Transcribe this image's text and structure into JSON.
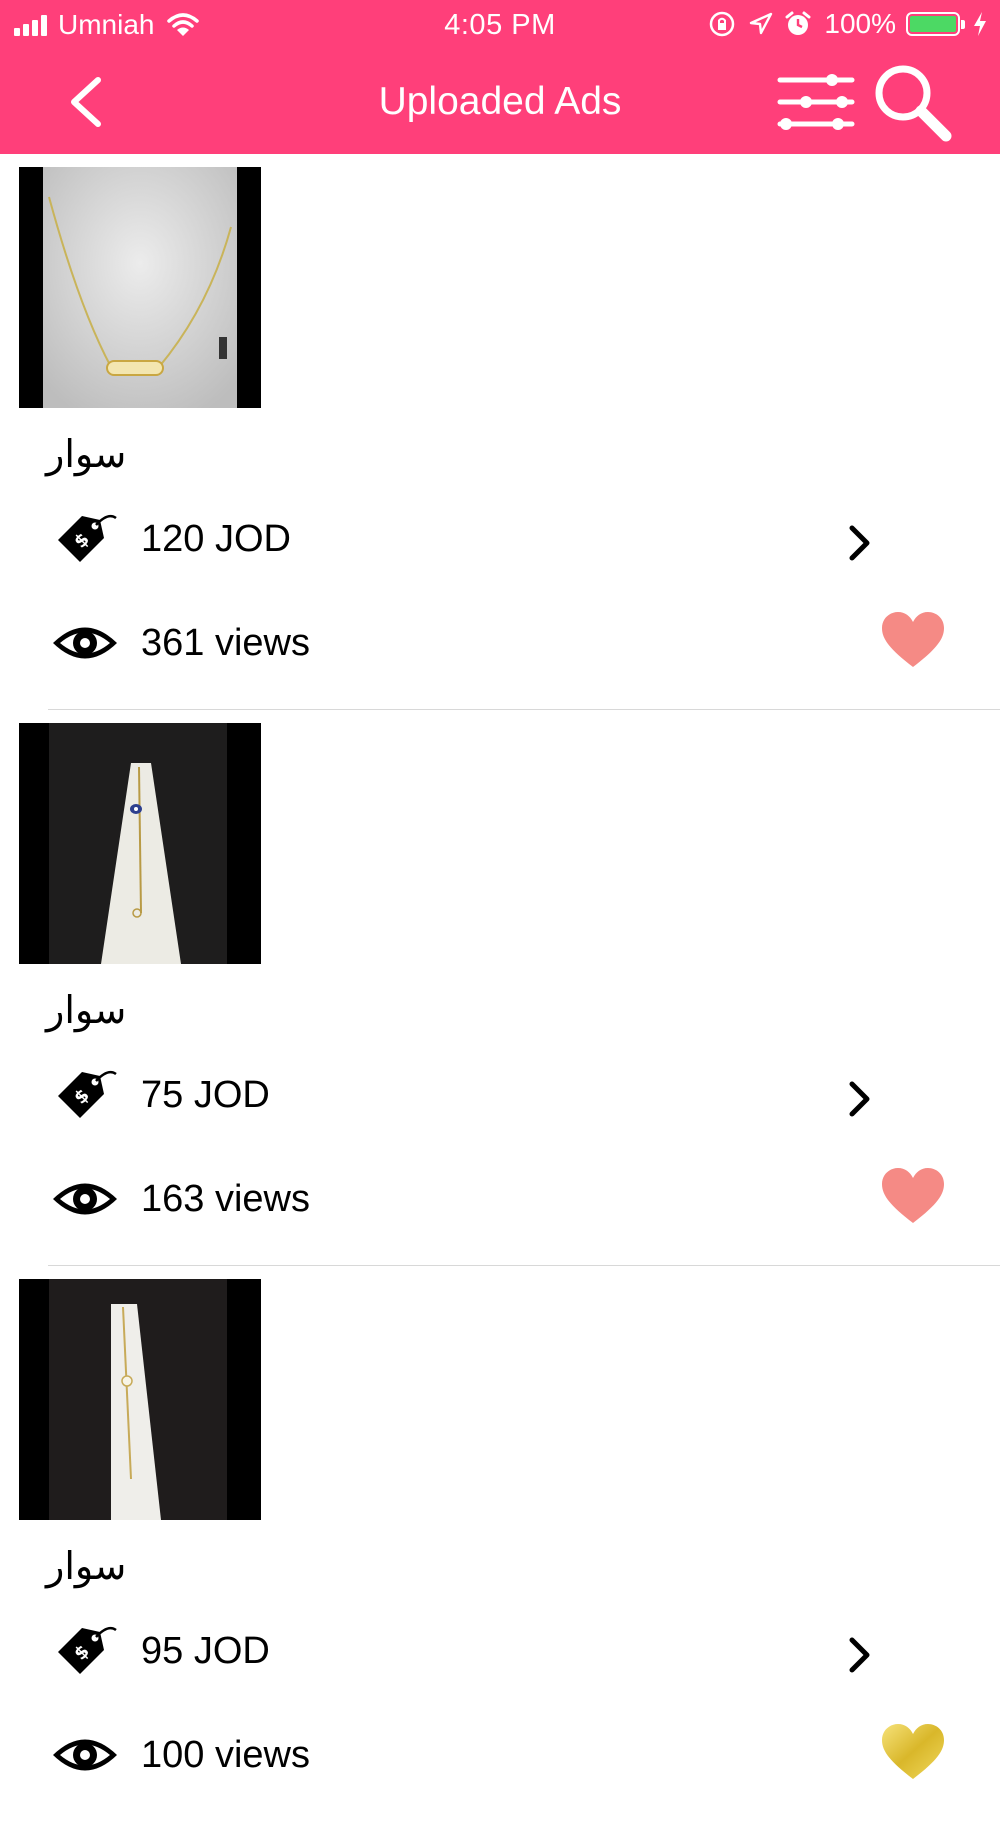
{
  "status_bar": {
    "carrier": "Umniah",
    "time": "4:05 PM",
    "battery": "100%",
    "battery_level": 1.0,
    "icons": [
      "signal-icon",
      "wifi-icon",
      "rotation-lock-icon",
      "location-icon",
      "alarm-icon",
      "battery-icon",
      "charging-icon"
    ]
  },
  "nav": {
    "title": "Uploaded Ads",
    "icons": [
      "back-chevron-icon",
      "filter-sliders-icon",
      "search-icon"
    ]
  },
  "colors": {
    "header": "#ff3f7a",
    "heart_pink": "#f58a85",
    "heart_gold": "#e3c21f",
    "divider": "#d8d8d8"
  },
  "ads": [
    {
      "title": "سوار",
      "price": "120 JOD",
      "views": "361 views",
      "favorite_style": "pink",
      "photo": "gold-necklace"
    },
    {
      "title": "سوار",
      "price": "75 JOD",
      "views": "163 views",
      "favorite_style": "pink",
      "photo": "bracelet-evil-eye"
    },
    {
      "title": "سوار",
      "price": "95 JOD",
      "views": "100 views",
      "favorite_style": "gold",
      "photo": "bracelet-heart"
    }
  ]
}
